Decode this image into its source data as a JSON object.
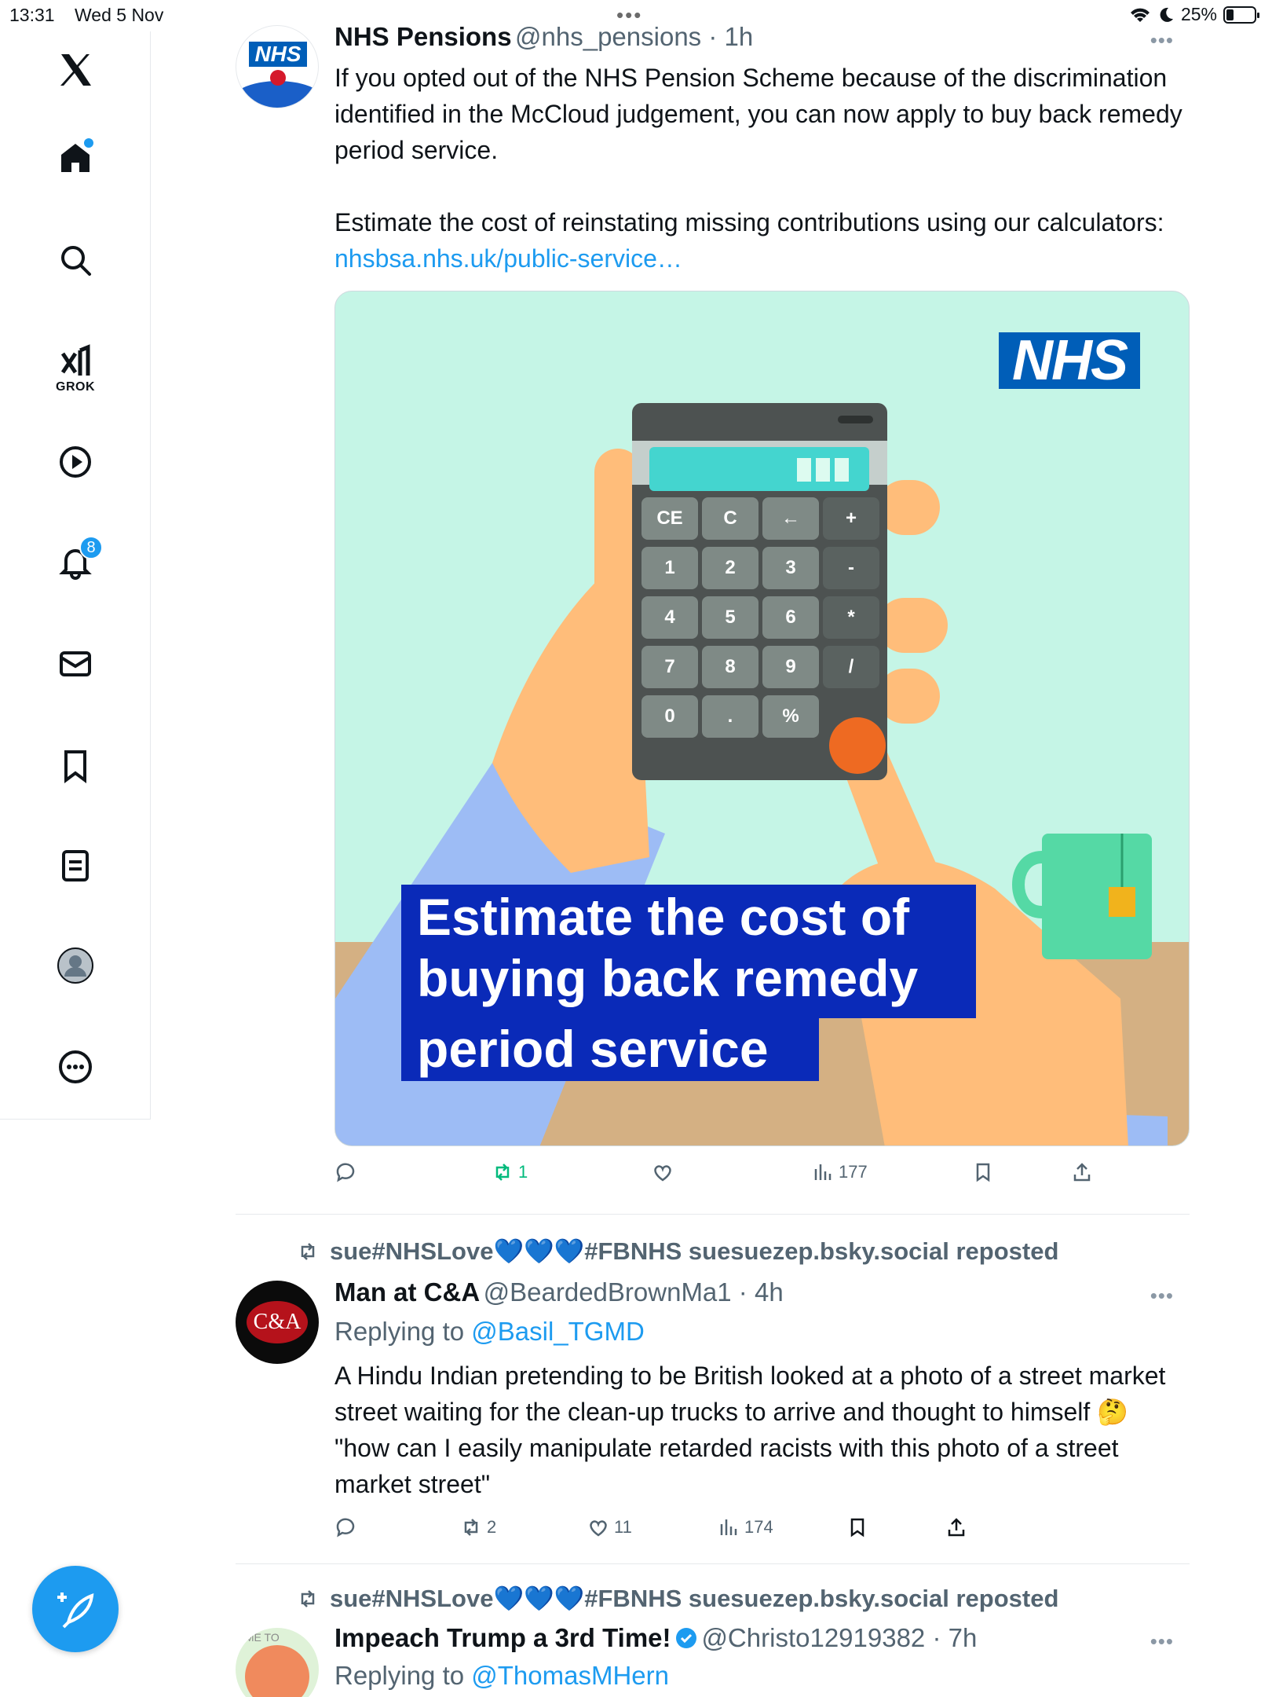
{
  "status_bar": {
    "time": "13:31",
    "date": "Wed 5 Nov",
    "battery": "25%",
    "battery_level": 0.25
  },
  "sidebar": {
    "items": [
      {
        "icon": "x-logo-icon"
      },
      {
        "icon": "home-icon"
      },
      {
        "icon": "search-icon"
      },
      {
        "icon": "grok-icon",
        "label": "GROK"
      },
      {
        "icon": "video-icon"
      },
      {
        "icon": "bell-icon",
        "badge": "8"
      },
      {
        "icon": "mail-icon"
      },
      {
        "icon": "bookmark-icon"
      },
      {
        "icon": "list-icon"
      },
      {
        "icon": "profile-icon"
      },
      {
        "icon": "more-icon"
      }
    ],
    "compose_icon": "compose-icon"
  },
  "tweets": [
    {
      "name": "NHS Pensions",
      "handle": "@nhs_pensions",
      "time": "1h",
      "body_p1": "If you opted out of the NHS Pension Scheme because of the discrimination identified in the McCloud judgement, you can now apply to buy back remedy period service.",
      "body_p2": "Estimate the cost of reinstating missing contributions using our calculators: ",
      "link": "nhsbsa.nhs.uk/public-service…",
      "avatar_text": "NHS",
      "media": {
        "logo": "NHS",
        "headline": [
          "Estimate the cost of",
          "buying back remedy",
          "period service"
        ],
        "keys": [
          "CE",
          "C",
          "←",
          "+",
          "1",
          "2",
          "3",
          "-",
          "4",
          "5",
          "6",
          "*",
          "7",
          "8",
          "9",
          "/",
          "0",
          ".",
          "%",
          ""
        ]
      },
      "actions": {
        "replies": "",
        "reposts": "1",
        "likes": "",
        "views": "177"
      }
    },
    {
      "repost_by": "sue#NHSLove💙💙💙#FBNHS suesuezep.bsky.social reposted",
      "name": "Man at C&A",
      "handle": "@BeardedBrownMa1",
      "time": "4h",
      "reply_prefix": "Replying to ",
      "reply_to": "@Basil_TGMD",
      "avatar_text": "C&A",
      "body": "A Hindu Indian pretending to be British looked at a photo of a street market street waiting for the clean-up trucks to arrive and thought to himself 🤔 \"how can I easily manipulate retarded racists with this photo of a street market street\"",
      "actions": {
        "replies": "",
        "reposts": "2",
        "likes": "11",
        "views": "174"
      }
    },
    {
      "repost_by": "sue#NHSLove💙💙💙#FBNHS suesuezep.bsky.social reposted",
      "name": "Impeach Trump a 3rd Time!",
      "handle": "@Christo12919382",
      "time": "7h",
      "reply_prefix": "Replying to ",
      "reply_to": "@ThomasMHern",
      "avatar_text": "IME TO"
    }
  ]
}
